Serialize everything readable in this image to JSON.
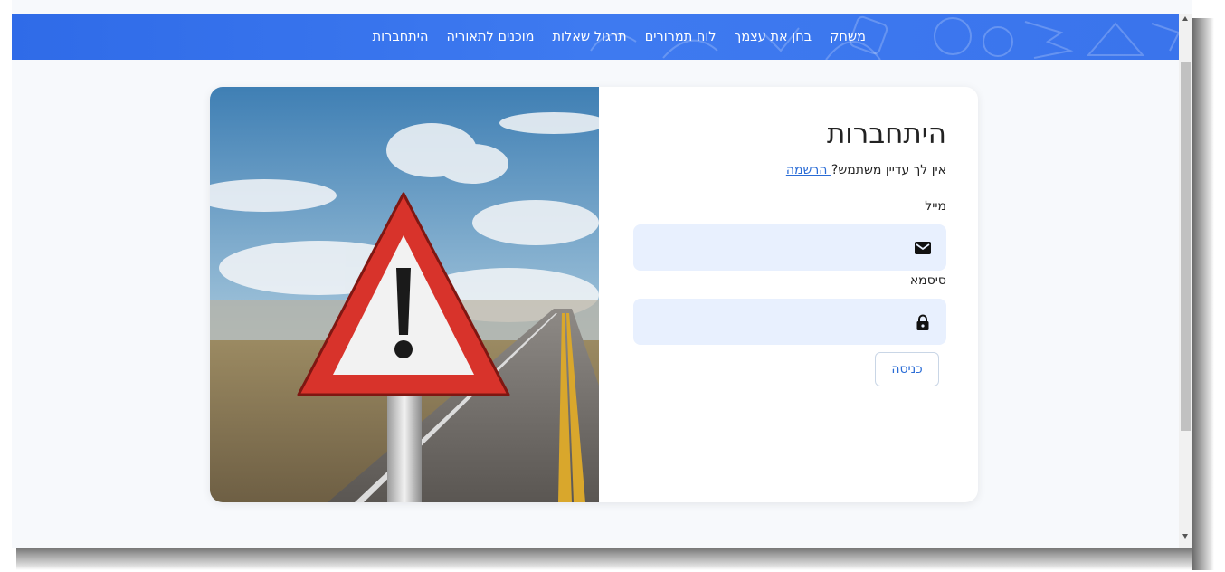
{
  "nav": {
    "items": [
      {
        "label": "משחק"
      },
      {
        "label": "בחן את עצמך"
      },
      {
        "label": "לוח תמרורים"
      },
      {
        "label": "תרגול שאלות"
      },
      {
        "label": "מוכנים לתאוריה"
      },
      {
        "label": "היתחברות"
      }
    ]
  },
  "login": {
    "title": "היתחברות",
    "signup_prompt": "אין לך עדיין משתמש?",
    "signup_link": " הרשמה",
    "email_label": "מייל",
    "email_value": "",
    "password_label": "סיסמא",
    "password_value": "",
    "submit_label": "כניסה"
  },
  "icons": {
    "email": "envelope-icon",
    "password": "lock-icon",
    "illustration": "warning-sign-road-image"
  },
  "colors": {
    "navbar": "#3a74ec",
    "field_bg": "#e8f0fe",
    "link": "#2a6cd6",
    "page_bg": "#f7f9fc",
    "warning_red": "#d8332b"
  }
}
